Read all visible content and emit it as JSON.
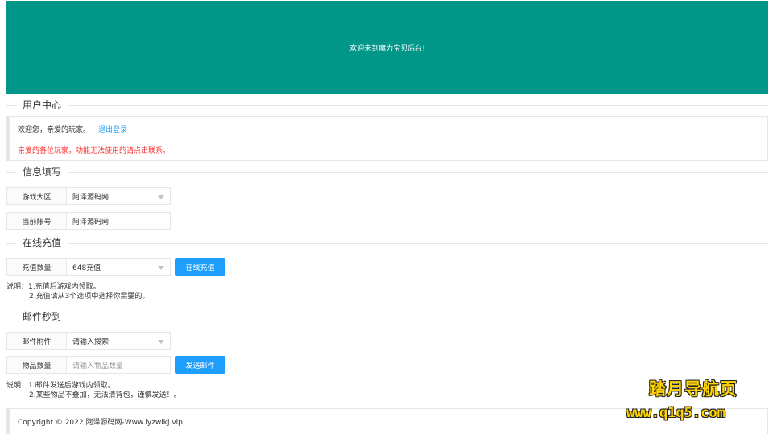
{
  "banner": {
    "text": "欢迎来到魔力宝贝后台!"
  },
  "user_center": {
    "legend": "用户中心",
    "welcome": "欢迎您，亲爱的玩家。",
    "logout": "退出登录",
    "warning": "亲爱的各位玩家，功能无法使用的请点击联系。"
  },
  "info": {
    "legend": "信息填写",
    "region_label": "游戏大区",
    "region_value": "阿泽源码网",
    "account_label": "当前账号",
    "account_value": "阿泽源码网"
  },
  "recharge": {
    "legend": "在线充值",
    "amount_label": "充值数量",
    "amount_value": "648充值",
    "button": "在线充值",
    "note_line1": "说明：1.充值后游戏内领取。",
    "note_line2": "2.充值请从3个选项中选择你需要的。"
  },
  "mail": {
    "legend": "邮件秒到",
    "attachment_label": "邮件附件",
    "attachment_value": "请输入搜索",
    "quantity_label": "物品数量",
    "quantity_placeholder": "请输入物品数量",
    "button": "发送邮件",
    "note_line1": "说明：1.邮件发送后游戏内领取。",
    "note_line2": "2.某些物品不叠加，无法清背包，谨慎发送！。"
  },
  "footer": {
    "text": "Copyright © 2022 阿泽源码网-Www.lyzwlkj.vip"
  },
  "watermark": {
    "line1": "踏月导航页",
    "line2": "www.q1q5.com"
  },
  "colors": {
    "primary": "#009688",
    "button": "#1e9fff",
    "warning": "#ff2d2d",
    "link": "#1e9fff",
    "watermark": "#ffd400"
  }
}
